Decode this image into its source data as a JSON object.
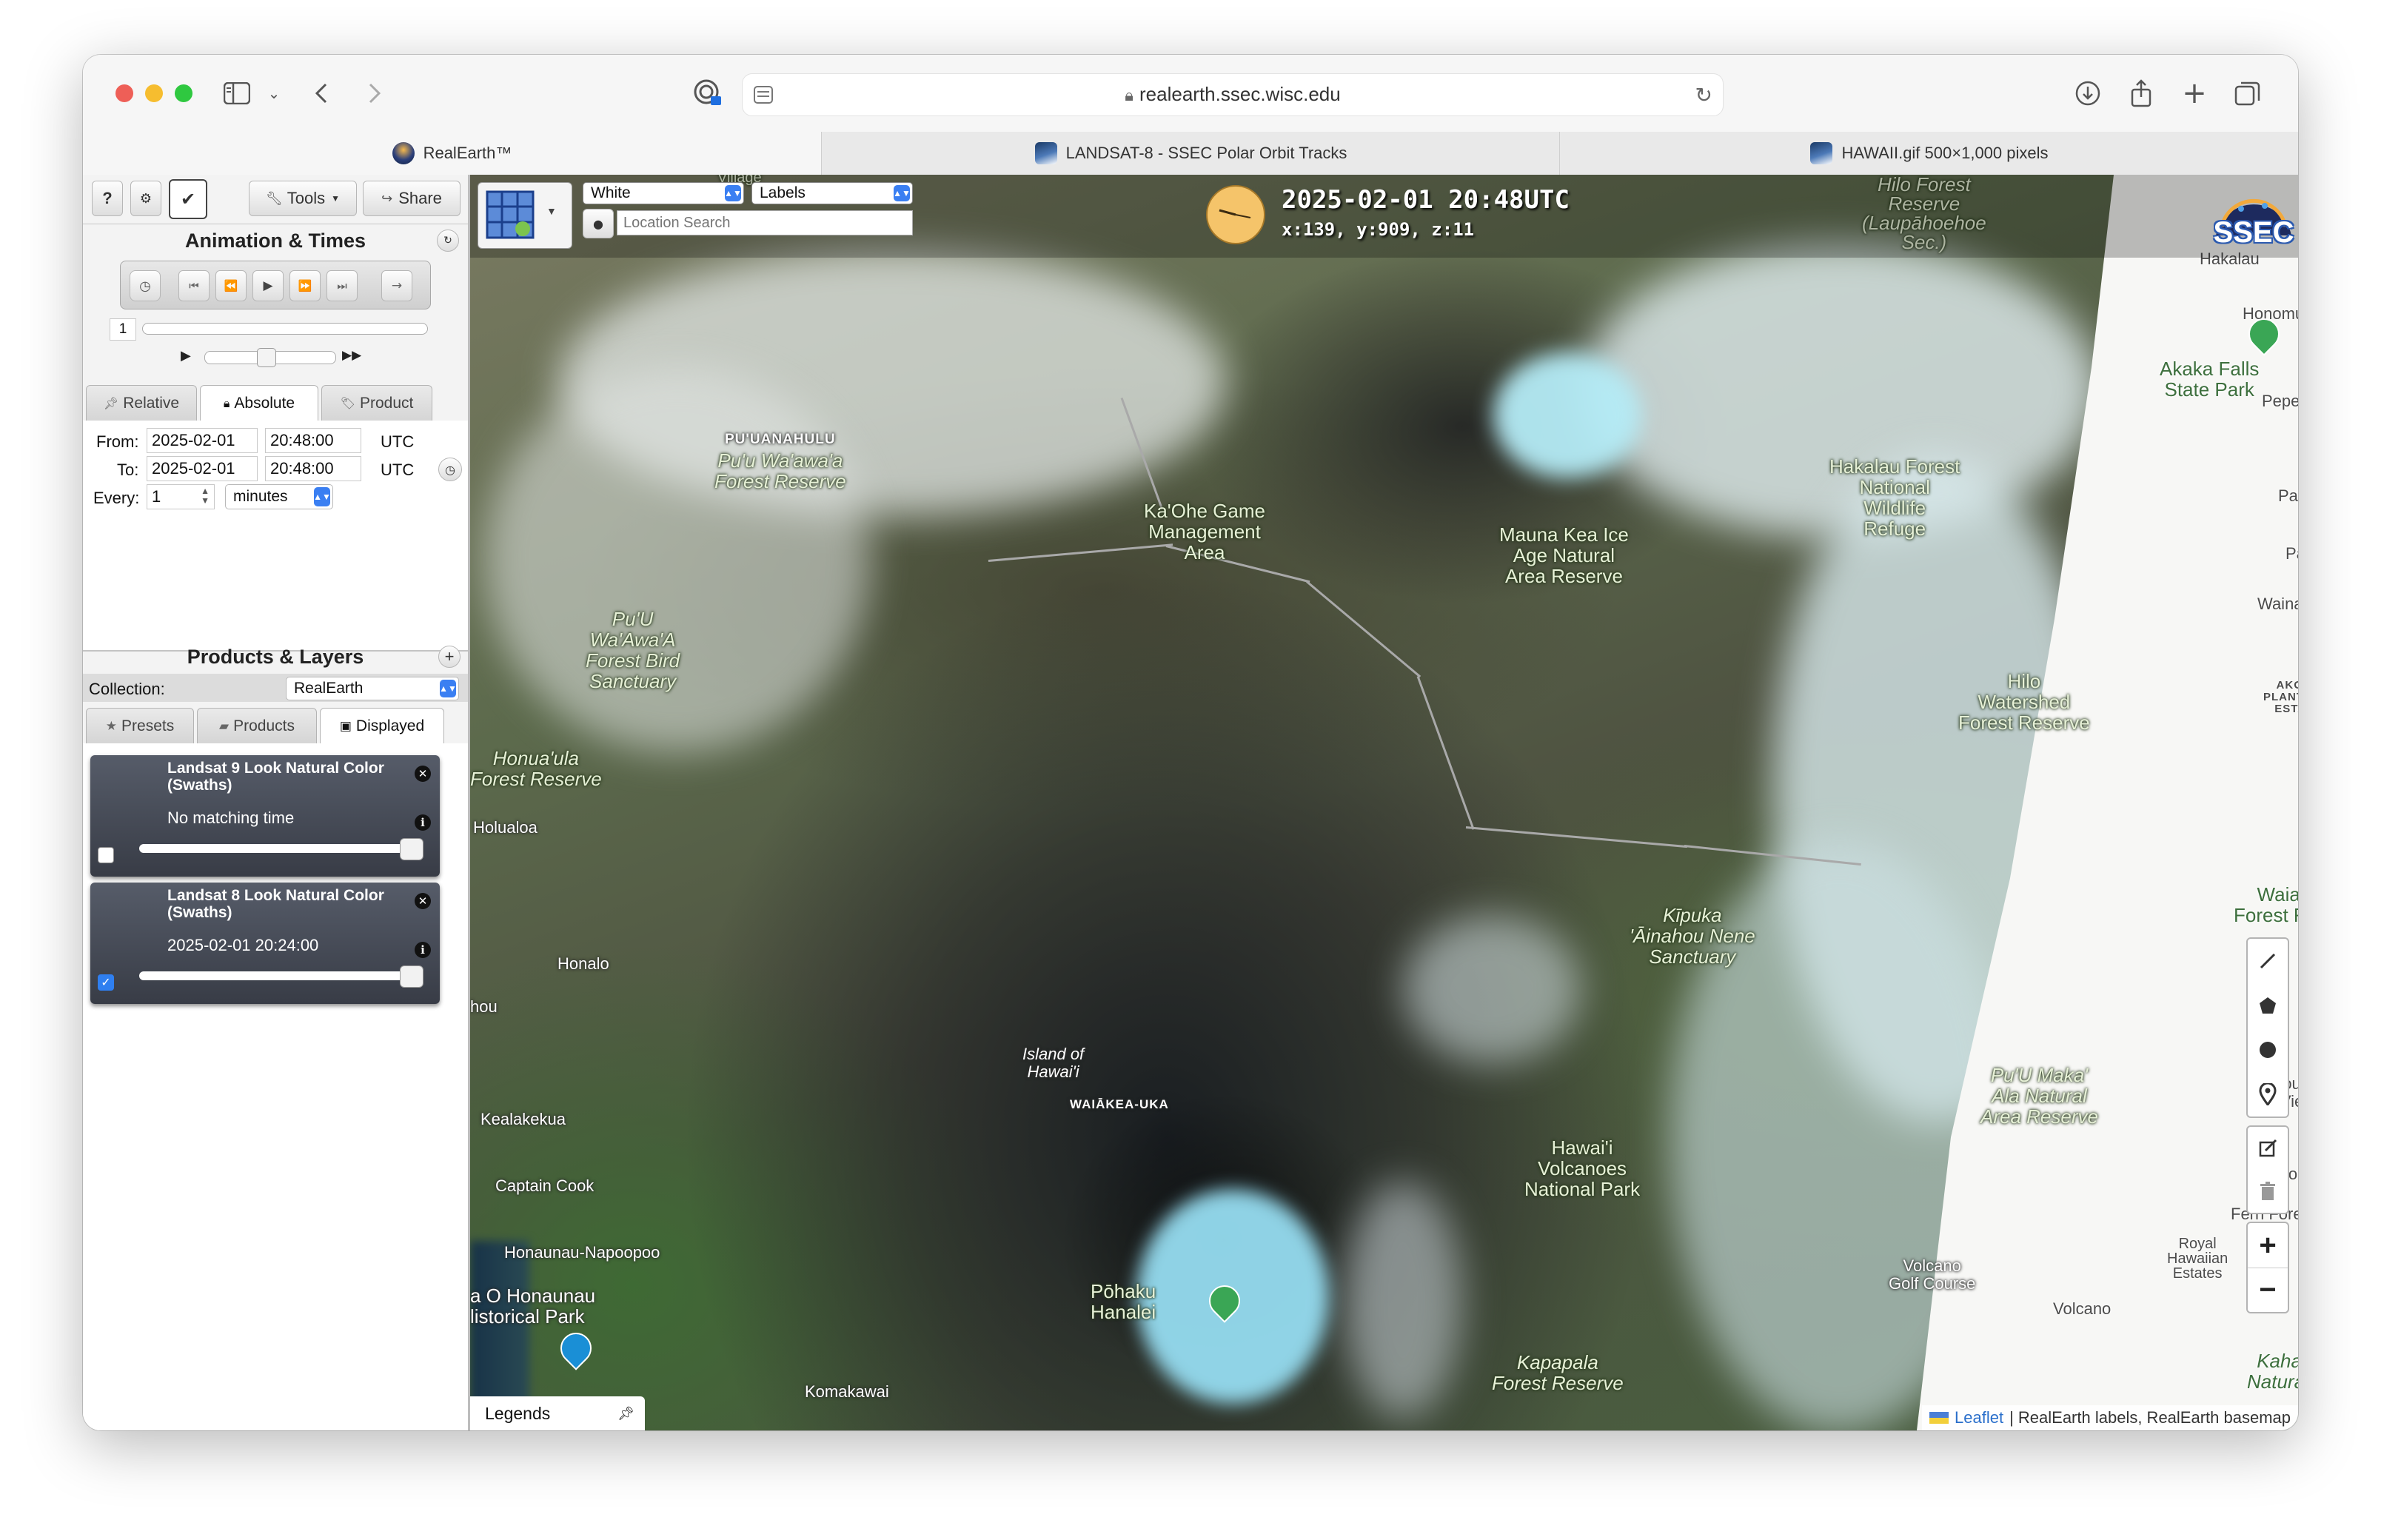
{
  "browser": {
    "address": "realearth.ssec.wisc.edu",
    "tabs": [
      {
        "title": "RealEarth™",
        "active": true
      },
      {
        "title": "LANDSAT-8 - SSEC Polar Orbit Tracks",
        "active": false
      },
      {
        "title": "HAWAII.gif 500×1,000 pixels",
        "active": false
      }
    ]
  },
  "sidebar": {
    "top_buttons": {
      "help": "?",
      "tools_label": "Tools",
      "share_label": "Share"
    },
    "animation": {
      "title": "Animation & Times",
      "frame_count": "1",
      "time_tabs": [
        "Relative",
        "Absolute",
        "Product"
      ],
      "from_label": "From:",
      "from_date": "2025-02-01",
      "from_time": "20:48:00",
      "to_label": "To:",
      "to_date": "2025-02-01",
      "to_time": "20:48:00",
      "tz": "UTC",
      "every_label": "Every:",
      "every_value": "1",
      "every_unit": "minutes"
    },
    "products": {
      "title": "Products & Layers",
      "collection_label": "Collection:",
      "collection_value": "RealEarth",
      "tabs": [
        "Presets",
        "Products",
        "Displayed"
      ],
      "layers": [
        {
          "name": "Landsat 9 Look Natural Color (Swaths)",
          "status": "No matching time",
          "checked": false
        },
        {
          "name": "Landsat 8 Look Natural Color (Swaths)",
          "status": "2025-02-01 20:24:00",
          "checked": true
        }
      ]
    }
  },
  "map": {
    "basemap_select": "White",
    "labels_select": "Labels",
    "search_placeholder": "Location Search",
    "datetime": "2025-02-01 20:48UTC",
    "coords": "x:139, y:909, z:11",
    "logo_text": "SSEC",
    "legends_label": "Legends",
    "attribution_link": "Leaflet",
    "attribution_text": "| RealEarth labels, RealEarth basemap",
    "labels": {
      "village": "Village",
      "hilo_forest": "Hilo Forest\nReserve\n(Laupāhoehoe\nSec.)",
      "hakalau": "Hakalau",
      "honomu": "Honomu",
      "akaka": "Akaka Falls\nState Park",
      "pepee": "Pepee",
      "papa": "Pap",
      "pa": "Pa",
      "wainaku": "Wainal",
      "puuanahulu": "PU'UANAHULU",
      "puu_waawaa": "Pu'u Wa'awa'a\nForest Reserve",
      "kaohe": "Ka'Ohe Game\nManagement\nArea",
      "mauna_kea": "Mauna Kea Ice\nAge Natural\nArea Reserve",
      "hakalau_forest": "Hakalau Forest\nNational\nWildlife\nRefuge",
      "puu_waawaa_bird": "Pu'U\nWa'Awa'A\nForest Bird\nSanctuary",
      "hilo_watershed": "Hilo\nWatershed\nForest Reserve",
      "akolea": "AKOLEA\nPLANTATION\nESTATES",
      "honuaula": "Honua'ula\nForest Reserve",
      "holualoa": "Holualoa",
      "waiakea_forest": "Waiakea\nForest Reserv",
      "kipuka": "Kīpuka\n'Āinahou Nene\nSanctuary",
      "honalo": "Honalo",
      "honaunau_left": "hou",
      "island": "Island of\nHawai'i",
      "waiakea_uka": "WAIĀKEA-UKA",
      "puu_makaala": "Pu'U Maka'\nAla Natural\nArea Reserve",
      "mountain_view": "Mount\nVie",
      "kealakekua": "Kealakekua",
      "hawaii_volcanoes": "Hawai'i\nVolcanoes\nNational Park",
      "captain_cook": "Captain Cook",
      "fern_forest": "Fern Forest",
      "royal": "Royal\nHawaiian\nEstates",
      "honaunau_napoopoo": "Honaunau-Napoopoo",
      "volcano_golf": "Volcano\nGolf Course",
      "volcano": "Volcano",
      "puuhonua": "a O Honaunau\nlistorical Park",
      "pohaku": "Pōhaku\nHanalei",
      "kapapala": "Kapapala\nForest Reserve",
      "kahauaea": "Kahauaea\nNatural Area",
      "komakawai": "Komakawai",
      "ro": "Ro"
    }
  }
}
